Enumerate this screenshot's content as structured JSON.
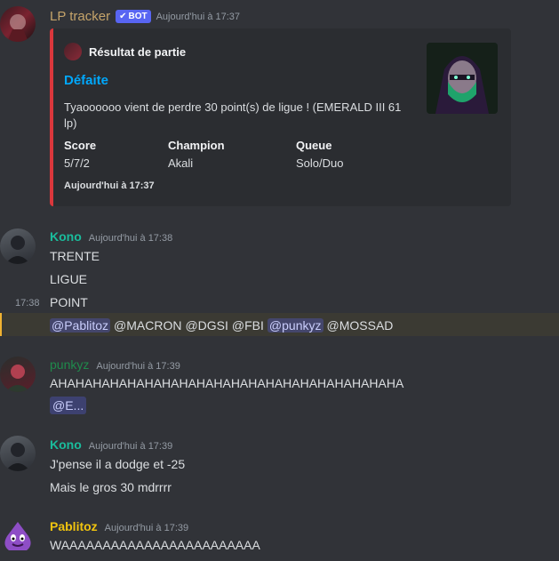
{
  "messages": {
    "bot": {
      "username": "LP tracker",
      "bot_tag": "BOT",
      "timestamp": "Aujourd'hui à 17:37",
      "embed": {
        "author": "Résultat de partie",
        "title": "Défaite",
        "description": "Tyaoooooo vient de perdre 30 point(s) de ligue ! (EMERALD III 61 lp)",
        "fields": [
          {
            "name": "Score",
            "value": "5/7/2"
          },
          {
            "name": "Champion",
            "value": "Akali"
          },
          {
            "name": "Queue",
            "value": "Solo/Duo"
          }
        ],
        "footer": "Aujourd'hui à 17:37",
        "color": "#da373c"
      }
    },
    "kono1": {
      "username": "Kono",
      "timestamp": "Aujourd'hui à 17:38",
      "lines": [
        "TRENTE",
        "LIGUE",
        "POINT"
      ],
      "hover_time": "17:38",
      "mention_line": {
        "mentions": [
          "@Pablitoz",
          "@MACRON",
          "@DGSI",
          "@FBI",
          "@punkyz",
          "@MOSSAD"
        ]
      }
    },
    "punkyz": {
      "username": "punkyz",
      "timestamp": "Aujourd'hui à 17:39",
      "line": "AHAHAHAHAHAHAHAHAHAHAHAHAHAHAHAHAHAHAHAHA",
      "mention": "@E..."
    },
    "kono2": {
      "username": "Kono",
      "timestamp": "Aujourd'hui à 17:39",
      "lines": [
        "J'pense il a dodge et -25",
        "Mais le gros 30 mdrrrr"
      ]
    },
    "pablitoz": {
      "username": "Pablitoz",
      "timestamp": "Aujourd'hui à 17:39",
      "line": "WAAAAAAAAAAAAAAAAAAAAAAAA"
    }
  },
  "colors": {
    "bot_name": "#c5a46a",
    "kono": "#1abc9c",
    "punkyz": "#1f8b4c",
    "pablitoz": "#f1c40f",
    "bot_tag": "#5865f2",
    "defeat_link": "#00a8fc"
  }
}
